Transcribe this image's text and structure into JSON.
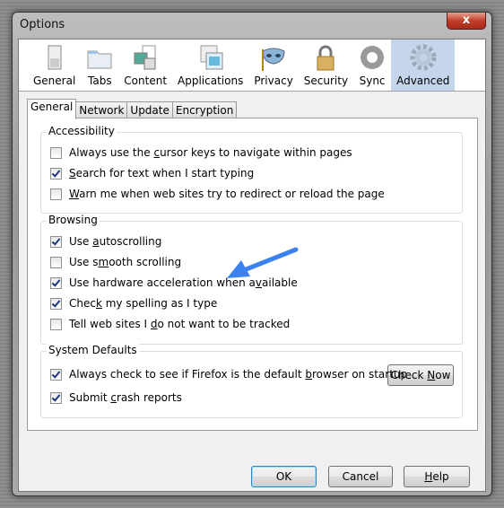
{
  "window": {
    "title": "Options",
    "close": "x"
  },
  "toolbar": [
    {
      "label": "General",
      "icon": "general-switch-icon"
    },
    {
      "label": "Tabs",
      "icon": "folder-tabs-icon"
    },
    {
      "label": "Content",
      "icon": "content-page-icon"
    },
    {
      "label": "Applications",
      "icon": "applications-icon"
    },
    {
      "label": "Privacy",
      "icon": "mask-icon"
    },
    {
      "label": "Security",
      "icon": "padlock-icon"
    },
    {
      "label": "Sync",
      "icon": "sync-icon"
    },
    {
      "label": "Advanced",
      "icon": "gear-icon",
      "selected": true
    }
  ],
  "tabs": [
    {
      "label": "General",
      "selected": true
    },
    {
      "label": "Network"
    },
    {
      "label": "Update"
    },
    {
      "label": "Encryption"
    }
  ],
  "groups": [
    {
      "title": "Accessibility",
      "items": [
        {
          "pre": "Always use the ",
          "key": "c",
          "post": "ursor keys to navigate within pages",
          "checked": false
        },
        {
          "pre": "",
          "key": "S",
          "post": "earch for text when I start typing",
          "checked": true
        },
        {
          "pre": "",
          "key": "W",
          "post": "arn me when web sites try to redirect or reload the page",
          "checked": false
        }
      ]
    },
    {
      "title": "Browsing",
      "items": [
        {
          "pre": "Use ",
          "key": "a",
          "post": "utoscrolling",
          "checked": true
        },
        {
          "pre": "Use s",
          "key": "m",
          "post": "ooth scrolling",
          "checked": false
        },
        {
          "pre": "Use hardware acceleration when a",
          "key": "v",
          "post": "ailable",
          "checked": true
        },
        {
          "pre": "Chec",
          "key": "k",
          "post": " my spelling as I type",
          "checked": true
        },
        {
          "pre": "Tell web sites I ",
          "key": "d",
          "post": "o not want to be tracked",
          "checked": false
        }
      ]
    },
    {
      "title": "System Defaults",
      "items": [
        {
          "pre": "Always check to see if Firefox is the default ",
          "key": "b",
          "post": "rowser on startup",
          "checked": true
        },
        {
          "pre": "Submit ",
          "key": "c",
          "post": "rash reports",
          "checked": true
        }
      ]
    }
  ],
  "check_now": {
    "pre": "Check ",
    "key": "N",
    "post": "ow"
  },
  "buttons": {
    "ok": "OK",
    "cancel": "Cancel",
    "help_key": "H",
    "help_post": "elp"
  },
  "annotation": {
    "arrow_color": "#3b82f0"
  }
}
